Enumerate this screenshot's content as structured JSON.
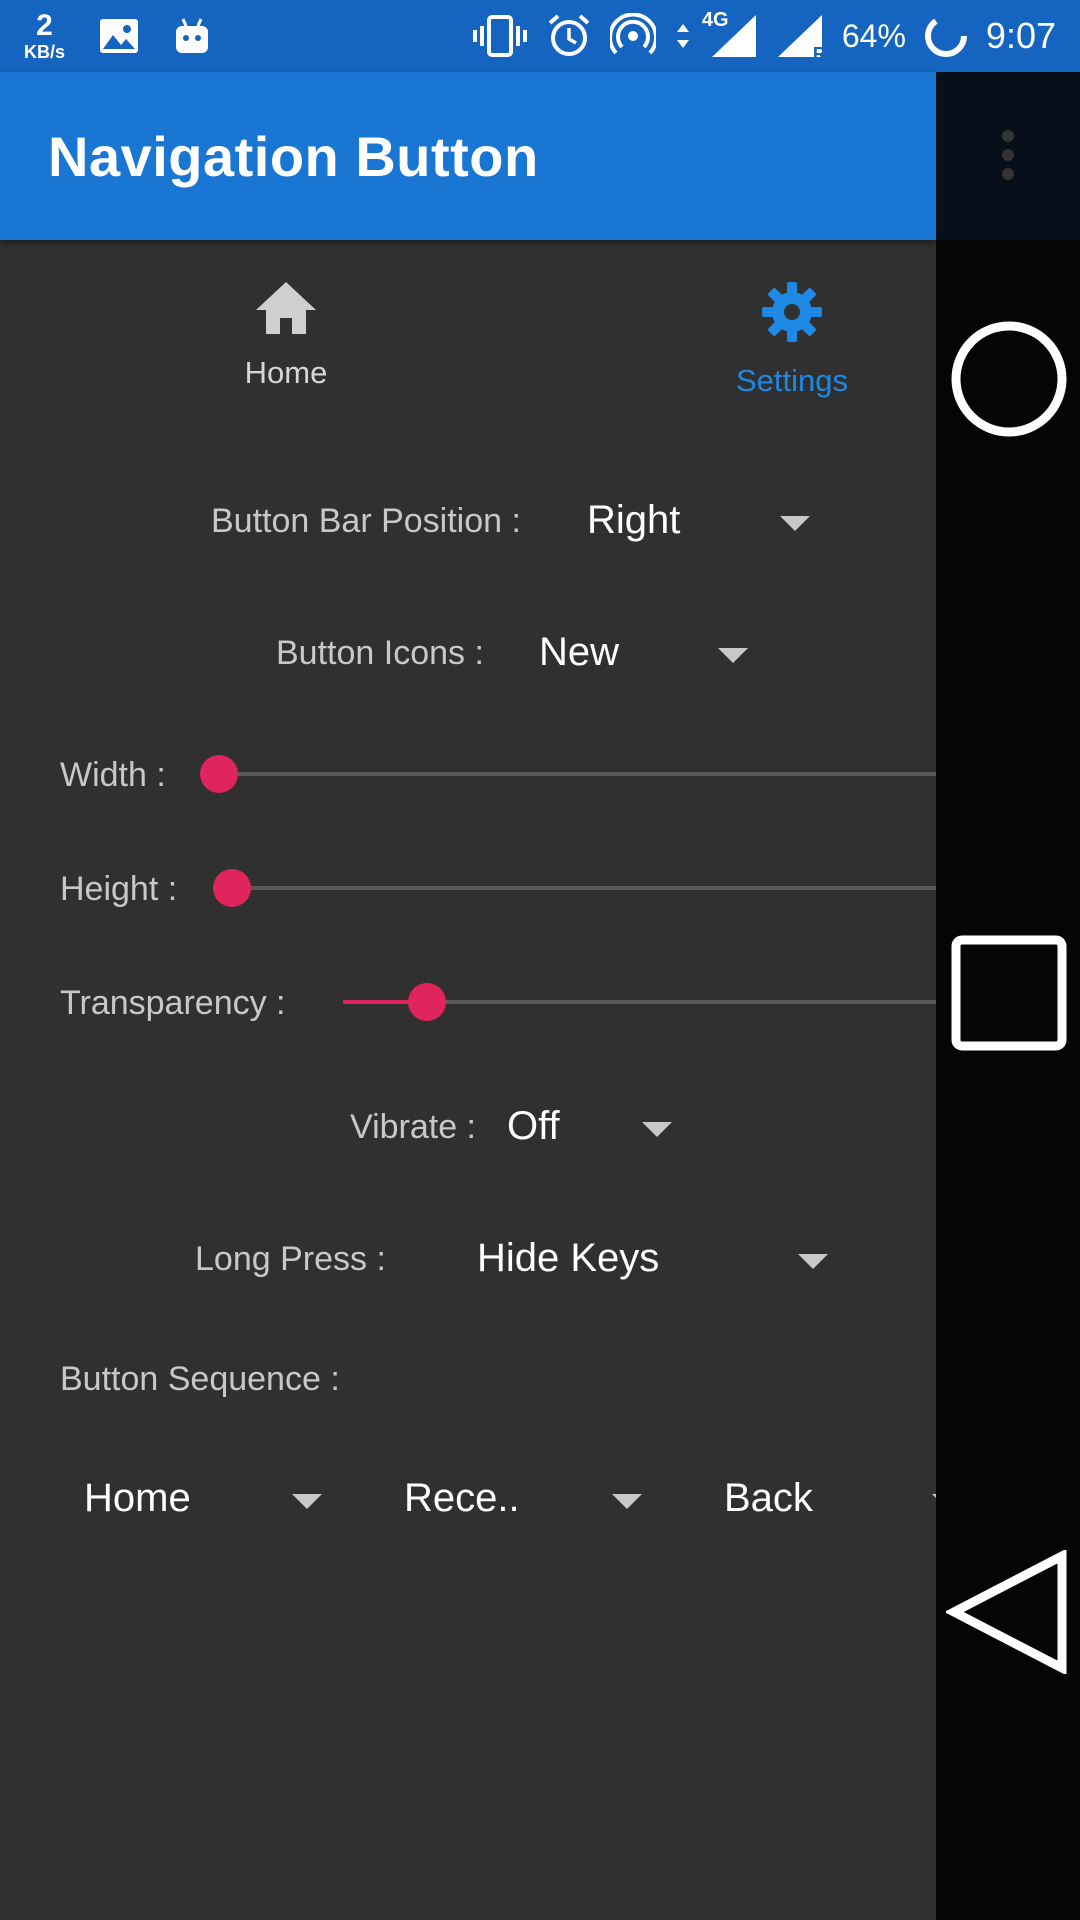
{
  "status_bar": {
    "net_speed_value": "2",
    "net_speed_unit": "KB/s",
    "network_type": "4G",
    "roaming_indicator": "R",
    "battery": "64%",
    "time": "9:07",
    "icons": [
      "image-icon",
      "android-icon",
      "vibrate-icon",
      "alarm-icon",
      "hotspot-icon",
      "data-arrows-icon",
      "signal-icon",
      "signal-roaming-icon",
      "battery-saver-icon"
    ]
  },
  "app_bar": {
    "title": "Navigation Button",
    "overflow_icon": "more-vert-icon",
    "color": "#1976d2"
  },
  "tabs": [
    {
      "label": "Home",
      "icon": "home-icon",
      "selected": false
    },
    {
      "label": "Settings",
      "icon": "gear-icon",
      "selected": true
    }
  ],
  "settings": {
    "bar_position": {
      "label": "Button Bar Position :",
      "value": "Right"
    },
    "button_icons": {
      "label": "Button Icons :",
      "value": "New"
    },
    "width": {
      "label": "Width :",
      "level": 0
    },
    "height": {
      "label": "Height :",
      "level": 0
    },
    "transparency": {
      "label": "Transparency :",
      "level": 0.14
    },
    "vibrate": {
      "label": "Vibrate :",
      "value": "Off"
    },
    "long_press": {
      "label": "Long Press :",
      "value": "Hide Keys"
    },
    "button_sequence": {
      "label": "Button Sequence :",
      "slots": [
        "Home",
        "Rece..",
        "Back"
      ]
    }
  },
  "nav_overlay": {
    "buttons": [
      "home-circle-icon",
      "recents-square-icon",
      "back-triangle-icon"
    ]
  },
  "colors": {
    "accent": "#e0245e",
    "selected_tab": "#1e88e5",
    "background": "#303030"
  }
}
